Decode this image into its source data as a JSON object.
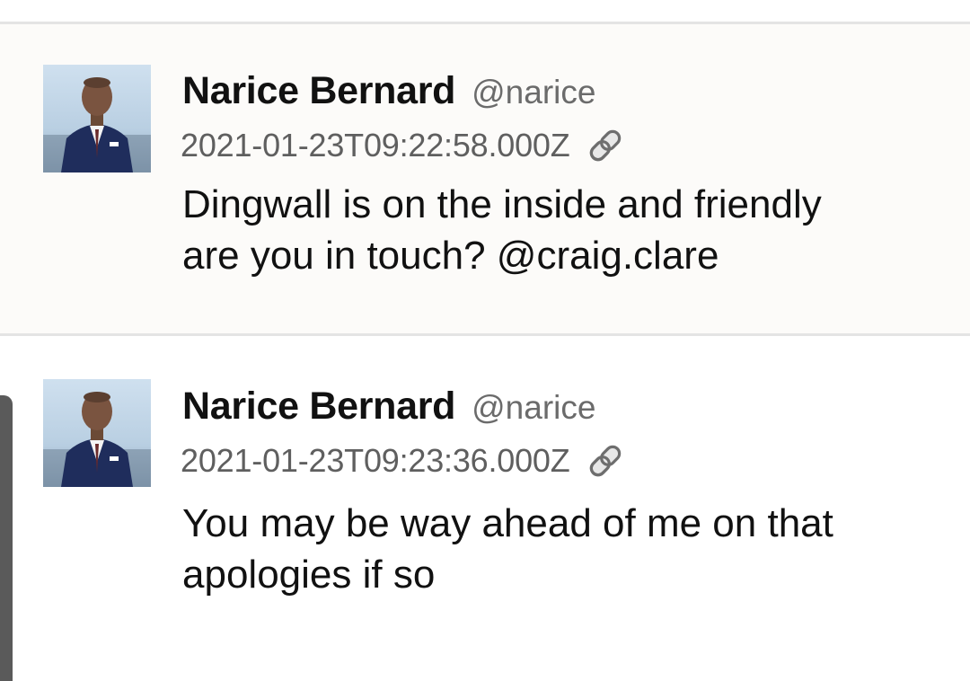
{
  "posts": [
    {
      "author_name": "Narice Bernard",
      "handle": "@narice",
      "timestamp": "2021-01-23T09:22:58.000Z",
      "body_line1": "Dingwall is on the inside and friendly",
      "body_line2": "are you in touch? @craig.clare",
      "link_icon": "link-chain-icon",
      "highlighted": true
    },
    {
      "author_name": "Narice Bernard",
      "handle": "@narice",
      "timestamp": "2021-01-23T09:23:36.000Z",
      "body_line1": "You may be way ahead of me on that",
      "body_line2": "apologies if so",
      "link_icon": "link-chain-icon",
      "highlighted": false
    }
  ],
  "colors": {
    "divider": "#e4e4e4",
    "highlight_bg": "#fcfbf9",
    "name": "#111111",
    "handle": "#6b6b6b",
    "timestamp": "#5f5f5f",
    "scroll_handle": "#5a5a5a"
  }
}
